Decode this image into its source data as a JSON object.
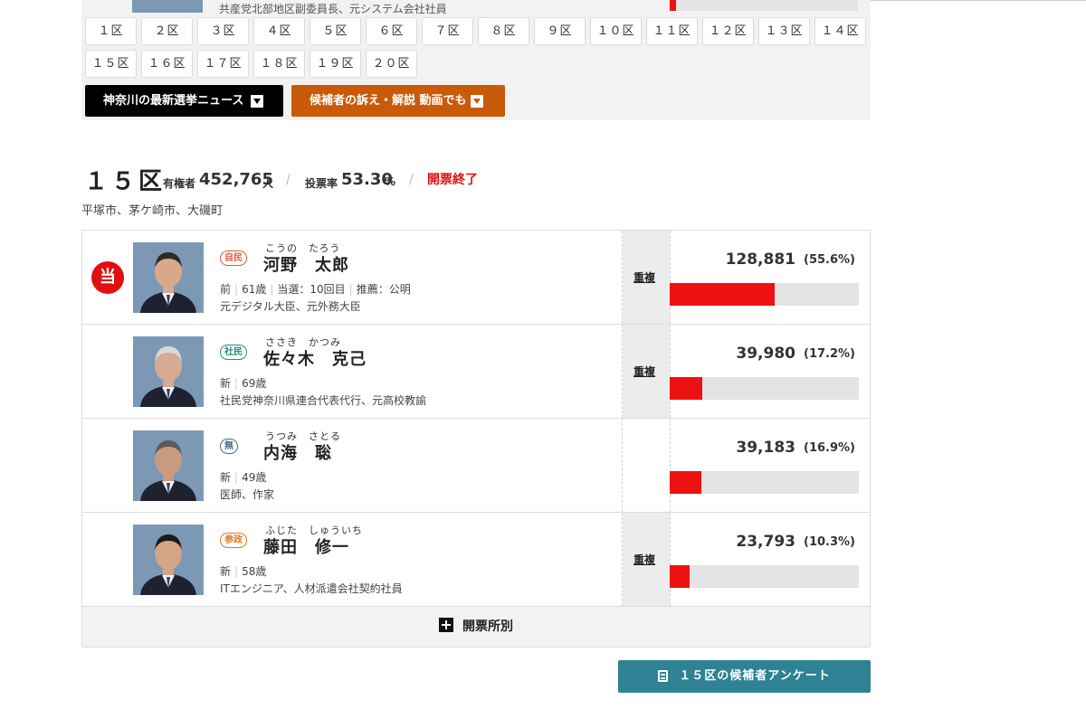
{
  "previous_district": {
    "career": "共産党北部地区副委員長、元システム会社社員",
    "vote_share_pct": 3.5
  },
  "district_buttons": [
    "１区",
    "２区",
    "３区",
    "４区",
    "５区",
    "６区",
    "７区",
    "８区",
    "９区",
    "１０区",
    "１１区",
    "１２区",
    "１３区",
    "１４区",
    "１５区",
    "１６区",
    "１７区",
    "１８区",
    "１９区",
    "２０区"
  ],
  "news_button": "神奈川の最新選挙ニュース",
  "video_button": "候補者の訴え・解説 動画でも",
  "district": {
    "title": "１５区",
    "electorate_label": "有権者",
    "electorate_value": "452,765",
    "electorate_unit": "人",
    "turnout_label": "投票率",
    "turnout_value": "53.30",
    "turnout_unit": "%",
    "separator": "/",
    "status": "開票終了",
    "area": "平塚市、茅ケ崎市、大磯町"
  },
  "candidates": [
    {
      "winner": true,
      "winner_label": "当",
      "party": "自民",
      "party_color": "#e05a3a",
      "kana": "こうの　たろう",
      "name": "河野　太郎",
      "details": [
        "前",
        "61歳",
        "当選：10回目",
        "推薦：公明"
      ],
      "career": "元デジタル大臣、元外務大臣",
      "duplicate": "重複",
      "votes": "128,881",
      "pct": "(55.6%)",
      "share": 55.6
    },
    {
      "winner": false,
      "party": "社民",
      "party_color": "#2a8a7a",
      "kana": "ささき　かつみ",
      "name": "佐々木　克己",
      "details": [
        "新",
        "69歳"
      ],
      "career": "社民党神奈川県連合代表代行、元高校教諭",
      "duplicate": "重複",
      "votes": "39,980",
      "pct": "(17.2%)",
      "share": 17.2
    },
    {
      "winner": false,
      "party": "無",
      "party_color": "#4a6a8a",
      "kana": "うつみ　さとる",
      "name": "内海　聡",
      "details": [
        "新",
        "49歳"
      ],
      "career": "医師、作家",
      "duplicate": "",
      "votes": "39,183",
      "pct": "(16.9%)",
      "share": 16.9
    },
    {
      "winner": false,
      "party": "参政",
      "party_color": "#e07a20",
      "kana": "ふじた　しゅういち",
      "name": "藤田　修一",
      "details": [
        "新",
        "58歳"
      ],
      "career": "ITエンジニア、人材派遣会社契約社員",
      "duplicate": "重複",
      "votes": "23,793",
      "pct": "(10.3%)",
      "share": 10.3
    }
  ],
  "kaihyo_button": "開票所別",
  "survey_button": "１５区の候補者アンケート",
  "colors": {
    "bar_fill": "#ee1111",
    "bar_track": "#e4e4e4",
    "winner_badge": "#e01010",
    "survey_button": "#2e8294",
    "video_button": "#c85a0a"
  }
}
